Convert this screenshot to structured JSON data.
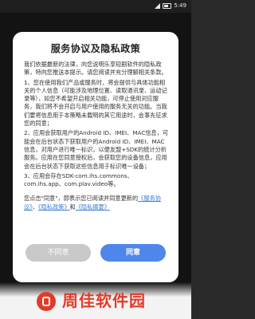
{
  "status_bar": {
    "time": "5:49"
  },
  "dialog": {
    "title": "服务协议及隐私政策",
    "paragraphs": [
      "我们依据最新的法律，向您说明乐享短剧软件的隐私政策，特向您推送本提示。请您阅读并充分理解相关条款。",
      "1、您在使用我们产品或服务时，将会提供与具体功能相关的个人信息（可能涉及地理位置、读取通讯录、运动记录等），如您不希望开启相关功能，可停止使用对应服务，我们将不会开启与用户使用的服务无关的功能。当我们要将信息用于本策略未载明的其它用途时，会事先征求您的同意；",
      "2、应用会获取用户的Android ID、IMEI、MAC信息，可能会在后台状态下获取用户的Android ID、IMEI、MAC信息，对用户进行唯一标识，以便友盟+SDK的统计分析服务。应用在您同意授权后，会获取您的设备信息，应用会在后台状态下获取这些信息用于标识唯一设备；",
      "3、应用会存在SDK-com.ihs.commons、com.ihs.app、com.plav.video等。"
    ],
    "consent": {
      "prefix": "您点击\"同意\"，即表示您已阅读并同意更新的",
      "link_service": "《服务协议》",
      "conj": "、",
      "link_privacy": "《隐私政策》",
      "conj2": "和",
      "link_summary": "《隐私摘要》"
    },
    "buttons": {
      "disagree": "不同意",
      "agree": "同意"
    }
  },
  "watermark": {
    "text": "周佳软件园"
  }
}
